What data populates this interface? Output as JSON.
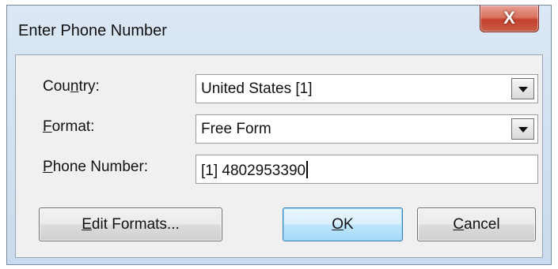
{
  "window": {
    "title": "Enter Phone Number",
    "close_label": "X"
  },
  "form": {
    "country": {
      "label_mnemonic_before": "Cou",
      "label_mnemonic_char": "n",
      "label_mnemonic_after": "try:",
      "value": "United States [1]"
    },
    "format": {
      "label_mnemonic_char": "F",
      "label_mnemonic_after": "ormat:",
      "value": "Free Form"
    },
    "phone": {
      "label_mnemonic_char": "P",
      "label_mnemonic_after": "hone Number:",
      "value": "[1] 4802953390"
    }
  },
  "buttons": {
    "edit_formats": {
      "mnemonic_char": "E",
      "rest": "dit Formats..."
    },
    "ok": {
      "mnemonic_char": "O",
      "rest": "K"
    },
    "cancel": {
      "mnemonic_char": "C",
      "rest": "ancel"
    }
  },
  "colors": {
    "close_button": "#c4412d",
    "default_button_border": "#3c7fb1",
    "frame": "#c9dbee"
  }
}
